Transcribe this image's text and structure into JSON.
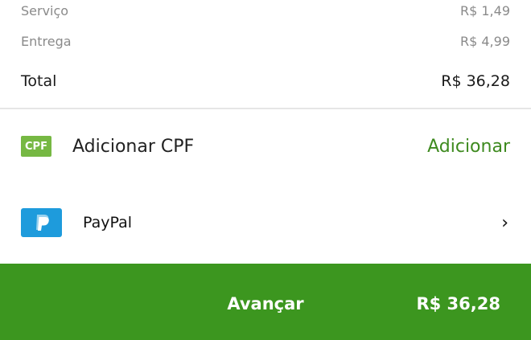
{
  "summary": {
    "service_label": "Serviço",
    "service_value": "R$ 1,49",
    "delivery_label": "Entrega",
    "delivery_value": "R$ 4,99",
    "total_label": "Total",
    "total_value": "R$ 36,28"
  },
  "cpf": {
    "badge": "CPF",
    "label": "Adicionar CPF",
    "action": "Adicionar"
  },
  "payment": {
    "icon": "paypal-icon",
    "label": "PayPal",
    "chevron": "›"
  },
  "footer": {
    "next_label": "Avançar",
    "price": "R$ 36,28"
  },
  "colors": {
    "accent": "#3c961f",
    "cpf_badge": "#76b843",
    "paypal_blue": "#1e9bdc"
  }
}
